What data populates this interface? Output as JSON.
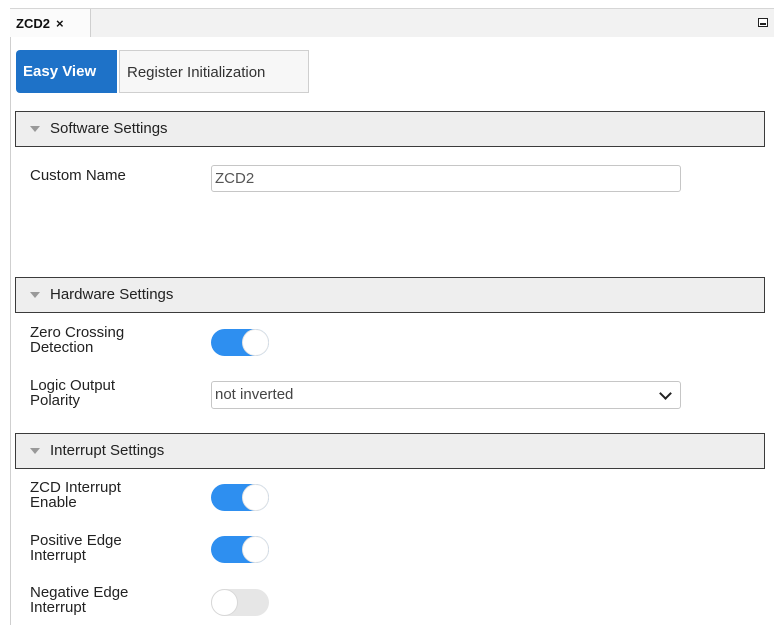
{
  "document_tab": {
    "title": "ZCD2",
    "close_glyph": "×"
  },
  "view_tabs": [
    {
      "label": "Easy View",
      "active": true
    },
    {
      "label": "Register Initialization",
      "active": false
    }
  ],
  "software_settings": {
    "header": "Software Settings",
    "custom_name": {
      "label": "Custom Name",
      "value": "ZCD2"
    }
  },
  "hardware_settings": {
    "header": "Hardware Settings",
    "zero_crossing": {
      "label_line1": "Zero Crossing",
      "label_line2": "Detection",
      "enabled": true
    },
    "logic_output_polarity": {
      "label_line1": "Logic Output",
      "label_line2": "Polarity",
      "selected": "not inverted"
    }
  },
  "interrupt_settings": {
    "header": "Interrupt Settings",
    "zcd_interrupt_enable": {
      "label_line1": "ZCD Interrupt",
      "label_line2": "Enable",
      "enabled": true
    },
    "positive_edge_interrupt": {
      "label_line1": "Positive Edge",
      "label_line2": "Interrupt",
      "enabled": true
    },
    "negative_edge_interrupt": {
      "label_line1": "Negative Edge",
      "label_line2": "Interrupt",
      "enabled": false
    }
  },
  "colors": {
    "active_tab": "#1e72c8",
    "toggle_on": "#2e8ff0",
    "toggle_off": "#e6e6e6",
    "section_header_bg": "#eeeeee"
  },
  "icons": {
    "collapse": "triangle-down-icon",
    "close": "close-icon",
    "minimize": "minimize-icon",
    "dropdown": "chevron-down-icon"
  }
}
